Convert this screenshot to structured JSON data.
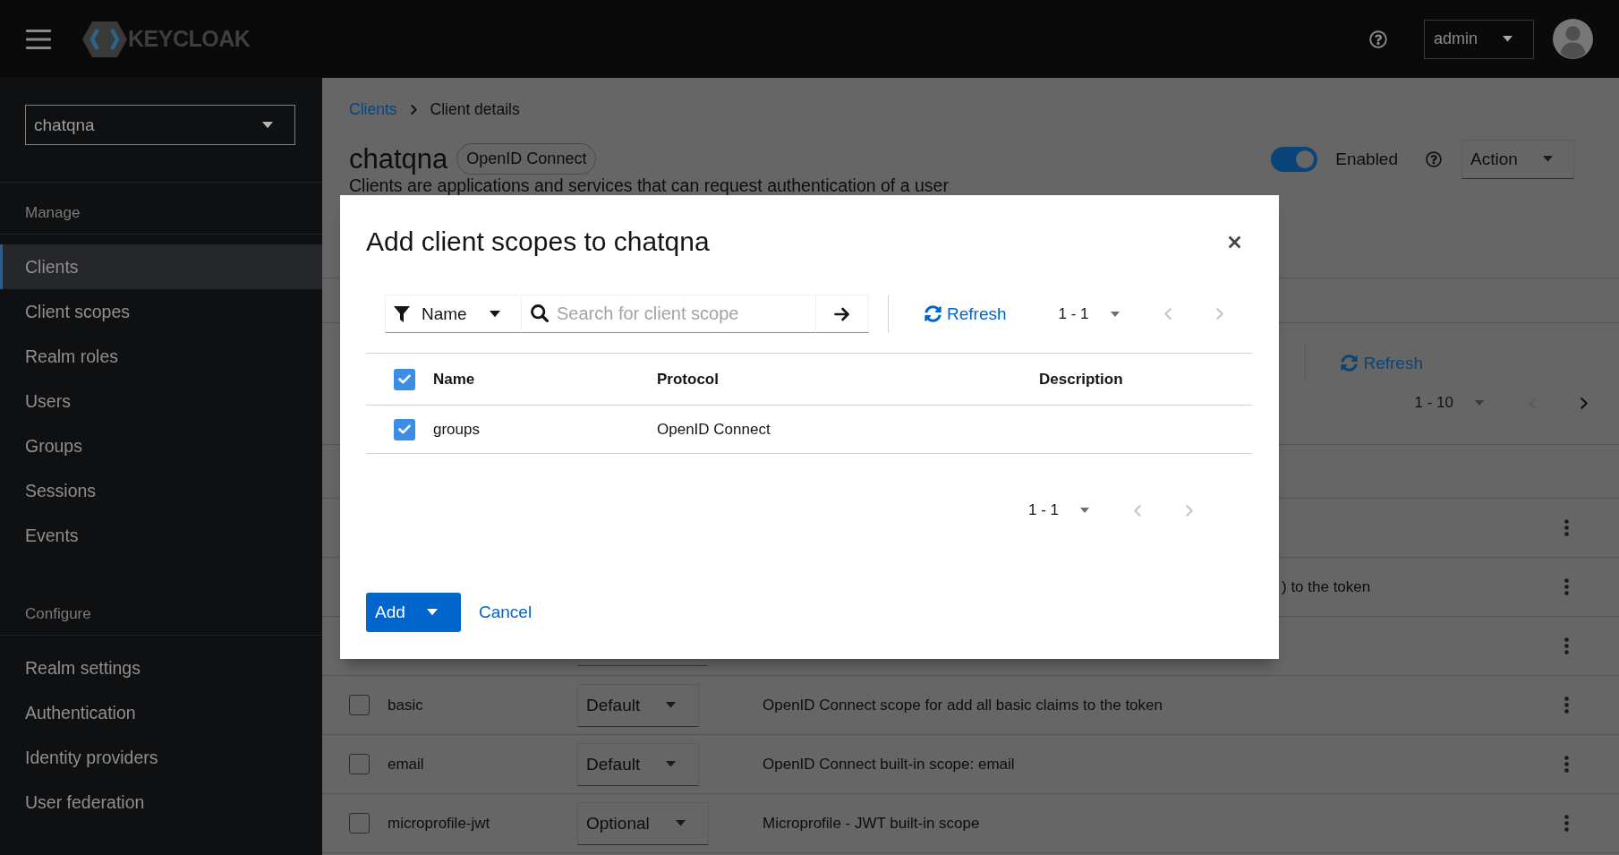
{
  "header": {
    "brand": "KEYCLOAK",
    "user_menu": "admin"
  },
  "sidebar": {
    "realm": "chatqna",
    "sections": [
      {
        "title": "Manage",
        "items": [
          {
            "label": "Clients",
            "selected": true
          },
          {
            "label": "Client scopes",
            "selected": false
          },
          {
            "label": "Realm roles",
            "selected": false
          },
          {
            "label": "Users",
            "selected": false
          },
          {
            "label": "Groups",
            "selected": false
          },
          {
            "label": "Sessions",
            "selected": false
          },
          {
            "label": "Events",
            "selected": false
          }
        ]
      },
      {
        "title": "Configure",
        "items": [
          {
            "label": "Realm settings",
            "selected": false
          },
          {
            "label": "Authentication",
            "selected": false
          },
          {
            "label": "Identity providers",
            "selected": false
          },
          {
            "label": "User federation",
            "selected": false
          }
        ]
      }
    ]
  },
  "breadcrumb": [
    {
      "label": "Clients",
      "kind": "link"
    },
    {
      "label": "Client details",
      "kind": "current"
    }
  ],
  "page_header": {
    "title": "chatqna",
    "badge": "OpenID Connect",
    "description": "Clients are applications and services that can request authentication of a user",
    "enabled_switch": {
      "label": "Enabled",
      "on": true
    },
    "action_menu": "Action"
  },
  "scopes_toolbar": {
    "refresh": "Refresh",
    "pagination": {
      "range": "1 - 10",
      "prev_disabled": true,
      "next_disabled": false
    }
  },
  "scopes_table": {
    "rows": [
      {
        "kind": "covered"
      },
      {
        "kind": "covered",
        "description": ") to the token"
      },
      {
        "kind": "covered"
      },
      {
        "kind": "full",
        "checked": false,
        "name": "basic",
        "type": "Default",
        "description": "OpenID Connect scope for add all basic claims to the token"
      },
      {
        "kind": "full",
        "checked": false,
        "name": "email",
        "type": "Default",
        "description": "OpenID Connect built-in scope: email"
      },
      {
        "kind": "full",
        "checked": false,
        "name": "microprofile-jwt",
        "type": "Optional",
        "description": "Microprofile - JWT built-in scope"
      }
    ]
  },
  "modal": {
    "title": "Add client scopes to chatqna",
    "filter": "Name",
    "search": {
      "placeholder": "Search for client scope"
    },
    "refresh": "Refresh",
    "pagination_top": {
      "range": "1 - 1",
      "prev_disabled": true,
      "next_disabled": true
    },
    "table": {
      "select_all": {
        "checked": true
      },
      "columns": [
        "Name",
        "Protocol",
        "Description"
      ],
      "rows": [
        {
          "checked": true,
          "name": "groups",
          "protocol": "OpenID Connect"
        }
      ]
    },
    "pagination_bottom": {
      "range": "1 - 1",
      "prev_disabled": true,
      "next_disabled": true
    },
    "buttons": {
      "add": "Add",
      "cancel": "Cancel"
    }
  }
}
